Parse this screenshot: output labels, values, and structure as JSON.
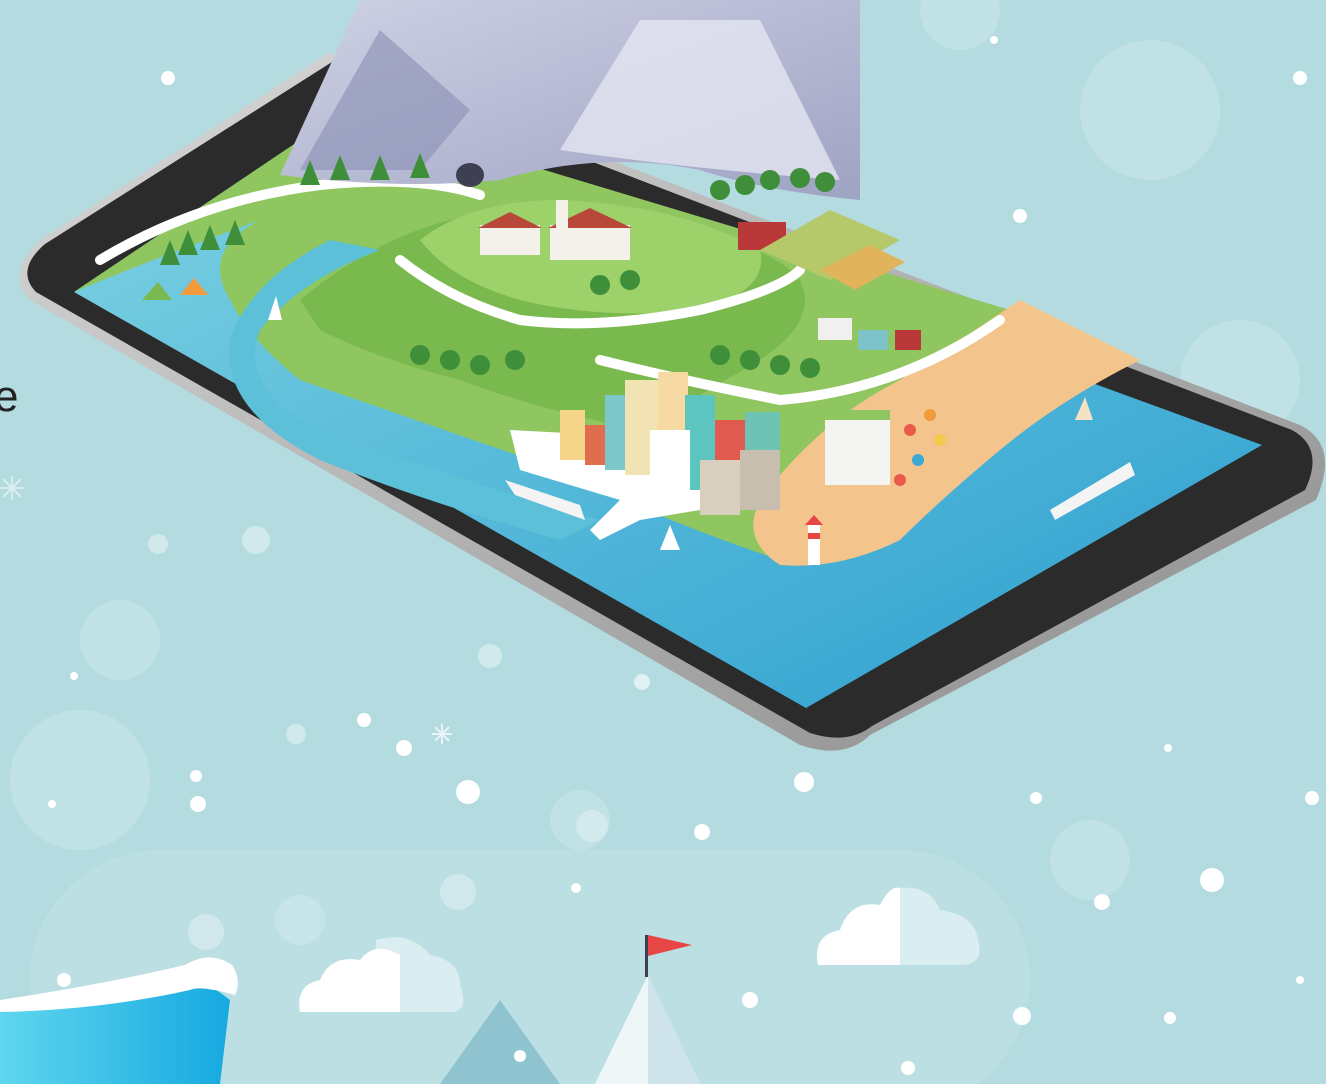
{
  "page": {
    "cropped_text": "e"
  },
  "colors": {
    "background": "#b3dbe0",
    "tablet_bezel": "#2b2b2b",
    "tablet_frame": "#b8b8b8",
    "water": "#3aa9d3",
    "grass": "#8fc65f",
    "sand": "#f3c48c",
    "mountain": "#b6b9d3",
    "flag": "#e84545"
  },
  "icons": [
    "snowflake-icon",
    "cloud-icon",
    "flag-icon",
    "sailboat-icon",
    "ship-icon",
    "lighthouse-icon",
    "tree-icon",
    "tent-icon"
  ]
}
